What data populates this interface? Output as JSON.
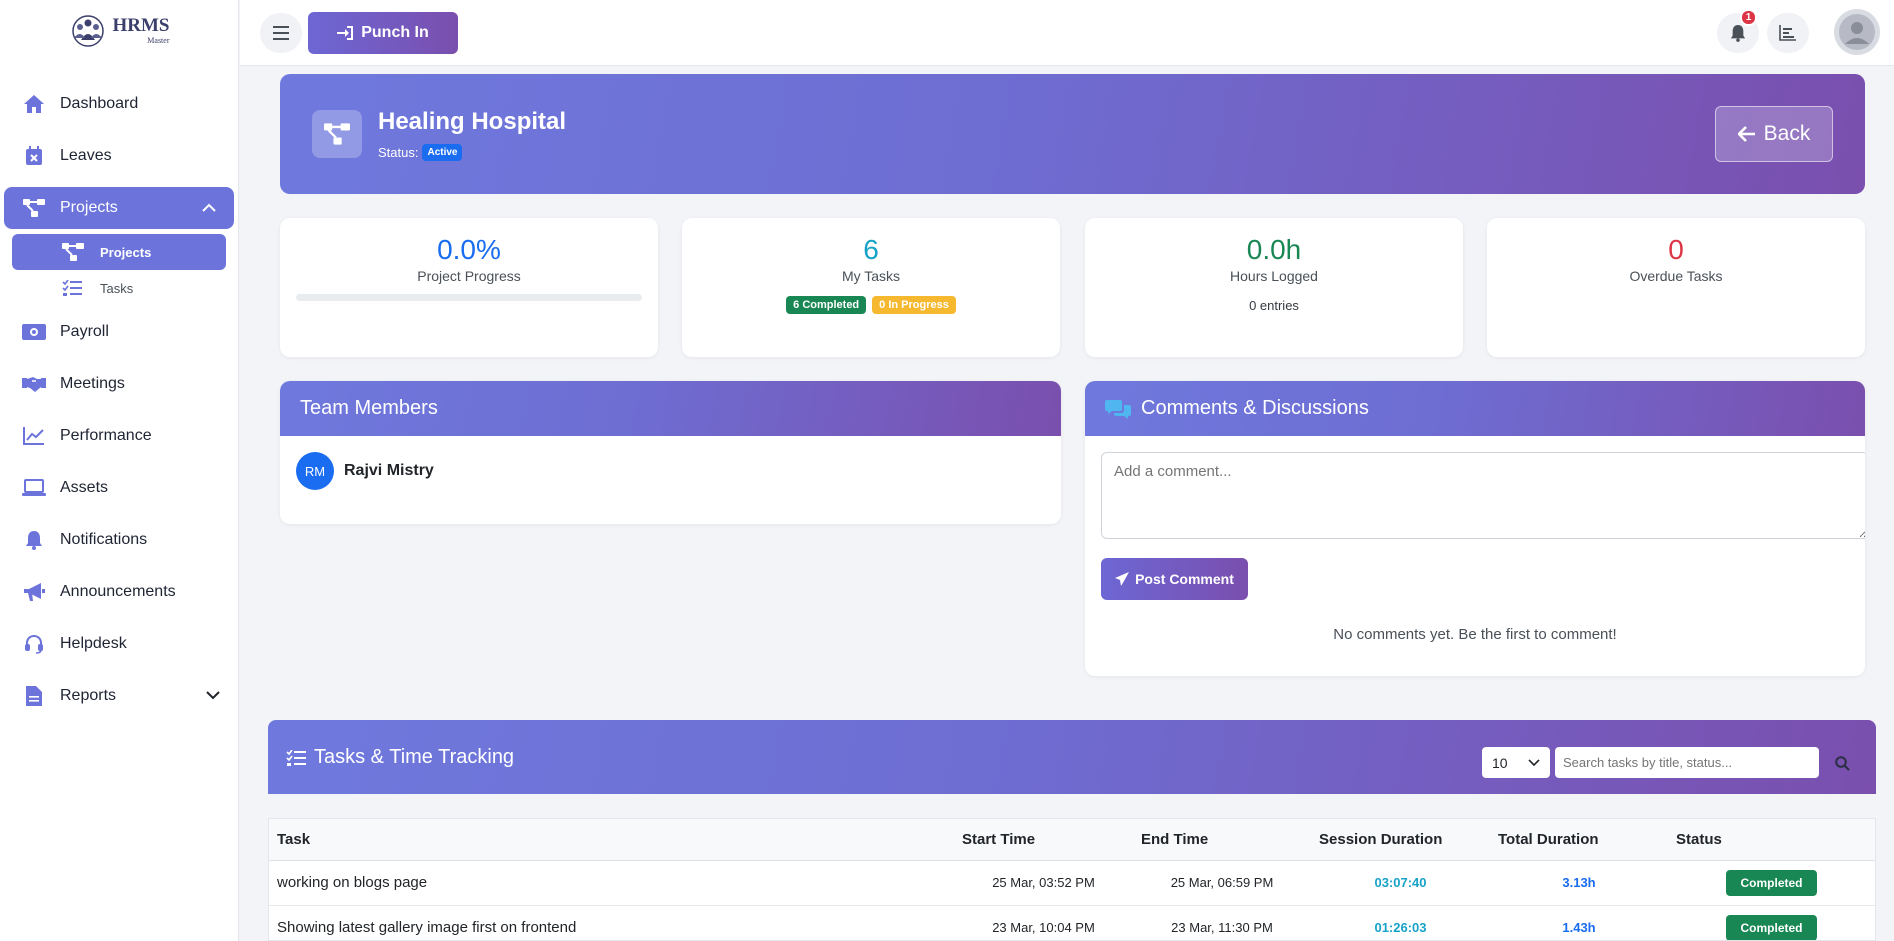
{
  "brand": {
    "name": "HRMS",
    "sub": "Master"
  },
  "sidebar": {
    "items": [
      {
        "label": "Dashboard"
      },
      {
        "label": "Leaves"
      },
      {
        "label": "Projects"
      },
      {
        "label": "Payroll"
      },
      {
        "label": "Meetings"
      },
      {
        "label": "Performance"
      },
      {
        "label": "Assets"
      },
      {
        "label": "Notifications"
      },
      {
        "label": "Announcements"
      },
      {
        "label": "Helpdesk"
      },
      {
        "label": "Reports"
      }
    ],
    "projects_sub": [
      {
        "label": "Projects"
      },
      {
        "label": "Tasks"
      }
    ]
  },
  "topbar": {
    "punch_label": "Punch In",
    "notif_count": "1"
  },
  "project": {
    "name": "Healing Hospital",
    "status_label": "Status:",
    "status": "Active",
    "back_label": "Back"
  },
  "stats": {
    "progress": {
      "value": "0.0%",
      "label": "Project Progress",
      "fraction": 0
    },
    "my_tasks": {
      "value": "6",
      "label": "My Tasks",
      "completed": "6 Completed",
      "in_progress": "0 In Progress"
    },
    "hours": {
      "value": "0.0h",
      "label": "Hours Logged",
      "entries": "0 entries"
    },
    "overdue": {
      "value": "0",
      "label": "Overdue Tasks"
    }
  },
  "team": {
    "title": "Team Members",
    "members": [
      {
        "initials": "RM",
        "name": "Rajvi Mistry"
      }
    ]
  },
  "comments": {
    "title": "Comments & Discussions",
    "placeholder": "Add a comment...",
    "post_label": "Post Comment",
    "empty": "No comments yet. Be the first to comment!"
  },
  "tasks": {
    "title": "Tasks & Time Tracking",
    "page_size": "10",
    "search_placeholder": "Search tasks by title, status...",
    "columns": {
      "task": "Task",
      "start": "Start Time",
      "end": "End Time",
      "session": "Session Duration",
      "total": "Total Duration",
      "status": "Status"
    },
    "rows": [
      {
        "task": "working on blogs page",
        "start": "25 Mar, 03:52 PM",
        "end": "25 Mar, 06:59 PM",
        "session": "03:07:40",
        "total": "3.13h",
        "status": "Completed"
      },
      {
        "task": "Showing latest gallery image first on frontend",
        "start": "23 Mar, 10:04 PM",
        "end": "23 Mar, 11:30 PM",
        "session": "01:26:03",
        "total": "1.43h",
        "status": "Completed"
      }
    ]
  },
  "colors": {
    "accent": "#6c74dc",
    "gradient_start": "#6f79dd",
    "gradient_end": "#7a4fae",
    "success": "#198754",
    "warning": "#f5b82e",
    "danger": "#dc3545",
    "info": "#17a2c8",
    "primary": "#1a6cf0"
  },
  "icons": [
    "home-icon",
    "calendar-x-icon",
    "project-diagram-icon",
    "money-icon",
    "handshake-icon",
    "chart-line-icon",
    "laptop-icon",
    "bell-icon",
    "bullhorn-icon",
    "headset-icon",
    "file-icon",
    "tasks-icon",
    "sign-in-icon",
    "menu-icon",
    "user-avatar-icon",
    "back-arrow-icon",
    "comments-icon",
    "paper-plane-icon",
    "search-icon"
  ]
}
